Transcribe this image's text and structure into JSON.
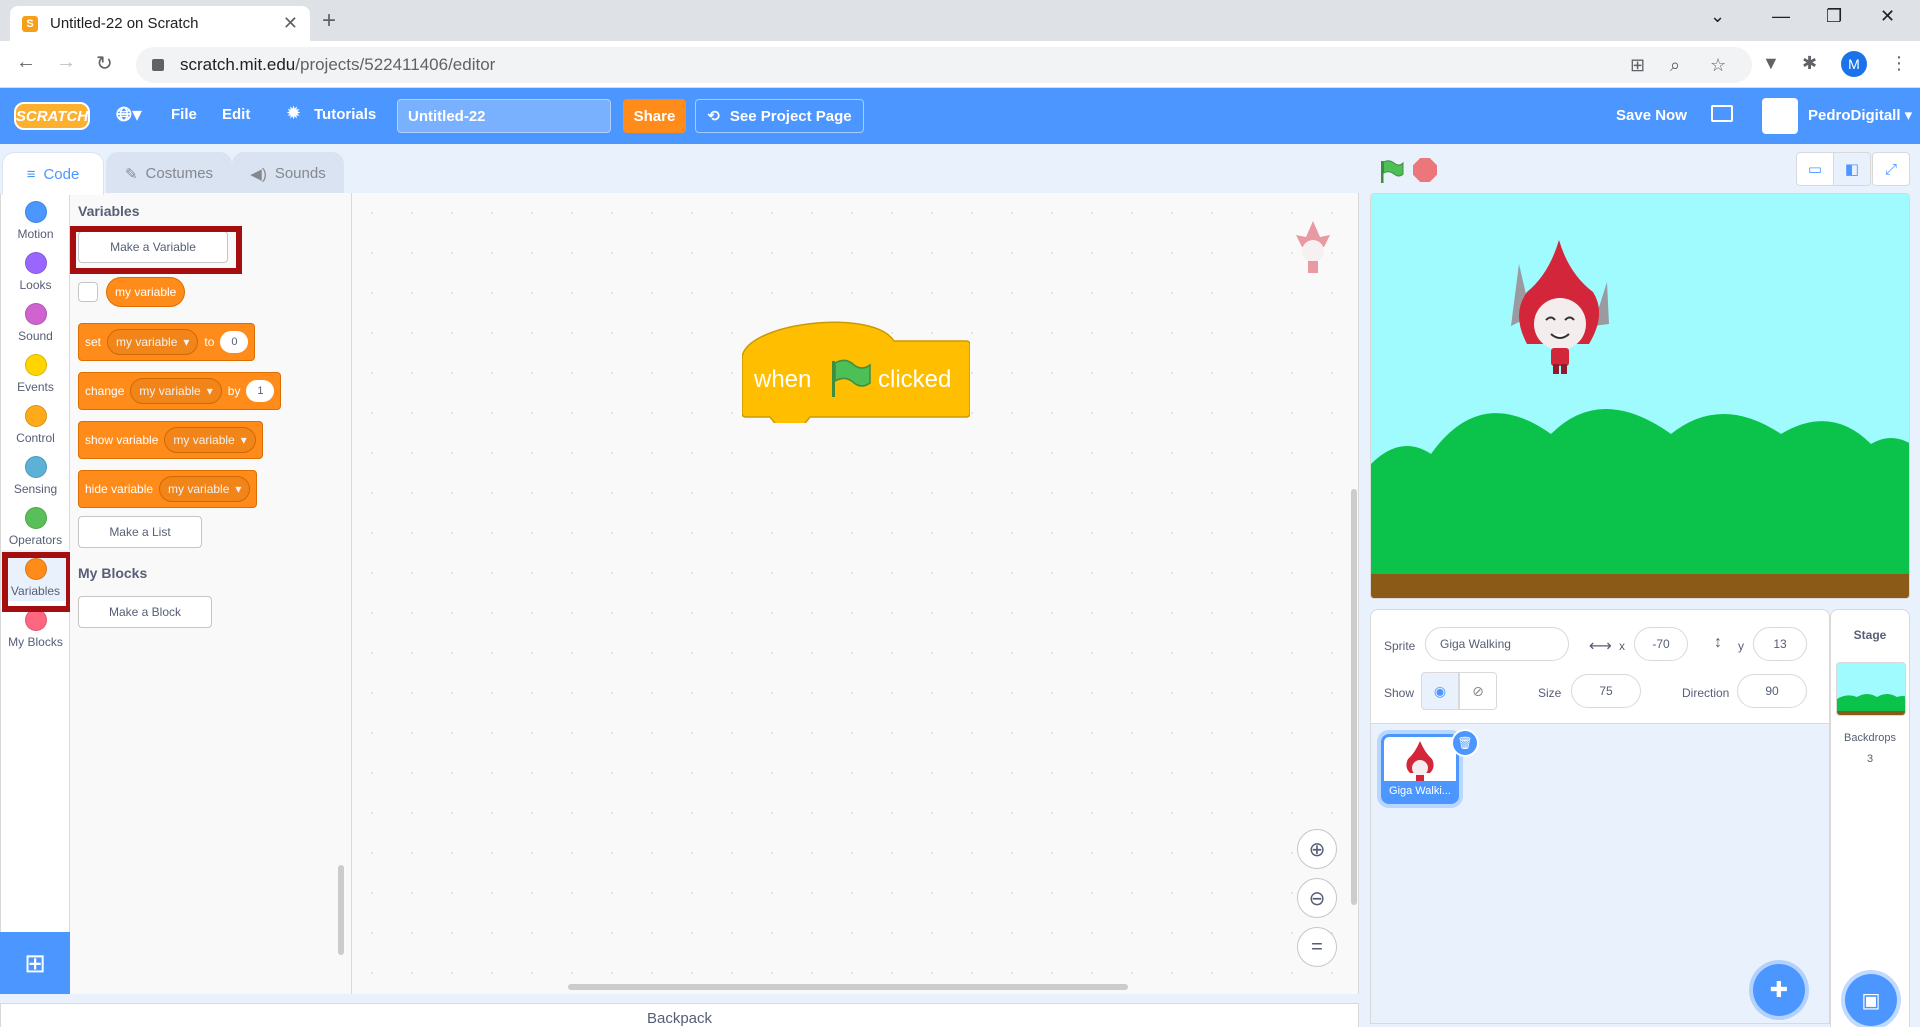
{
  "browser": {
    "tab_title": "Untitled-22 on Scratch",
    "url_host": "scratch.mit.edu",
    "url_path": "/projects/522411406/editor",
    "profile_initial": "M"
  },
  "menubar": {
    "logo": "SCRATCH",
    "file": "File",
    "edit": "Edit",
    "tutorials": "Tutorials",
    "project_title": "Untitled-22",
    "share": "Share",
    "see_project": "See Project Page",
    "save_now": "Save Now",
    "username": "PedroDigitall"
  },
  "editor_tabs": {
    "code": "Code",
    "costumes": "Costumes",
    "sounds": "Sounds"
  },
  "categories": [
    {
      "label": "Motion",
      "color": "#4c97ff"
    },
    {
      "label": "Looks",
      "color": "#9966ff"
    },
    {
      "label": "Sound",
      "color": "#cf63cf"
    },
    {
      "label": "Events",
      "color": "#ffd500"
    },
    {
      "label": "Control",
      "color": "#ffab19"
    },
    {
      "label": "Sensing",
      "color": "#5cb1d6"
    },
    {
      "label": "Operators",
      "color": "#59c059"
    },
    {
      "label": "Variables",
      "color": "#ff8c1a"
    },
    {
      "label": "My Blocks",
      "color": "#ff6680"
    }
  ],
  "palette": {
    "variables_heading": "Variables",
    "make_variable": "Make a Variable",
    "my_variable": "my variable",
    "set_label": "set",
    "set_to": "to",
    "set_value": "0",
    "change_label": "change",
    "change_by": "by",
    "change_value": "1",
    "show_variable": "show variable",
    "hide_variable": "hide variable",
    "make_list": "Make a List",
    "my_blocks_heading": "My Blocks",
    "make_block": "Make a Block"
  },
  "script": {
    "hat_when": "when",
    "hat_clicked": "clicked"
  },
  "backpack": "Backpack",
  "sprite_info": {
    "sprite_label": "Sprite",
    "sprite_name": "Giga Walking",
    "x_label": "x",
    "x_value": "-70",
    "y_label": "y",
    "y_value": "13",
    "show_label": "Show",
    "size_label": "Size",
    "size_value": "75",
    "direction_label": "Direction",
    "direction_value": "90"
  },
  "sprite_list": {
    "tile_name": "Giga Walki..."
  },
  "stage_panel": {
    "title": "Stage",
    "backdrops_label": "Backdrops",
    "backdrops_count": "3"
  },
  "colors": {
    "scratch_blue": "#4c97ff",
    "variables_orange": "#ff8c1a",
    "events_yellow": "#ffbf00",
    "highlight_red": "#a50e0e"
  }
}
